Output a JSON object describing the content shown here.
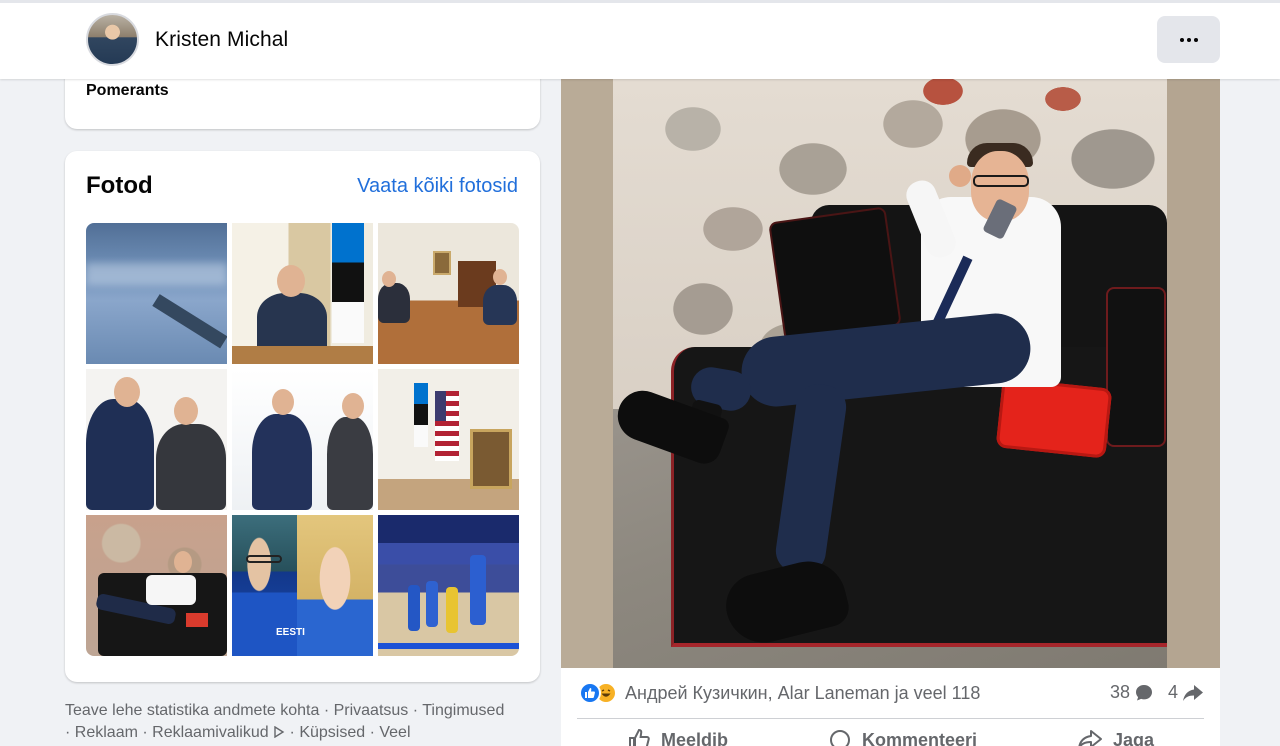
{
  "header": {
    "profile_name": "Kristen Michal",
    "more_label": "..."
  },
  "intro": {
    "text": "Pomerants"
  },
  "photos": {
    "title": "Fotod",
    "see_all": "Vaata kõiki fotosid",
    "thumb_text_estonia": "EESTI"
  },
  "footer": {
    "links": [
      "Teave lehe statistika andmete kohta",
      "Privaatsus",
      "Tingimused",
      "Reklaam",
      "Reklaamivalikud",
      "Küpsised",
      "Veel"
    ],
    "separator": " · "
  },
  "post": {
    "reaction_names": "Андрей Кузичкин, Alar Laneman ja veel 118",
    "comments_count": "38",
    "shares_count": "4",
    "actions": [
      "Meeldib",
      "Kommenteeri",
      "Jaga"
    ]
  },
  "colors": {
    "link_blue": "#216fdb",
    "like_blue": "#1877f2",
    "haha_yellow": "#f7b125",
    "secondary_text": "#65676b"
  },
  "icons": {
    "more": "more-horizontal-icon",
    "like_reaction": "like-reaction-icon",
    "haha_reaction": "haha-reaction-icon",
    "comment": "comment-bubble-icon",
    "share": "share-arrow-icon",
    "ad_choices": "ad-choices-icon"
  }
}
